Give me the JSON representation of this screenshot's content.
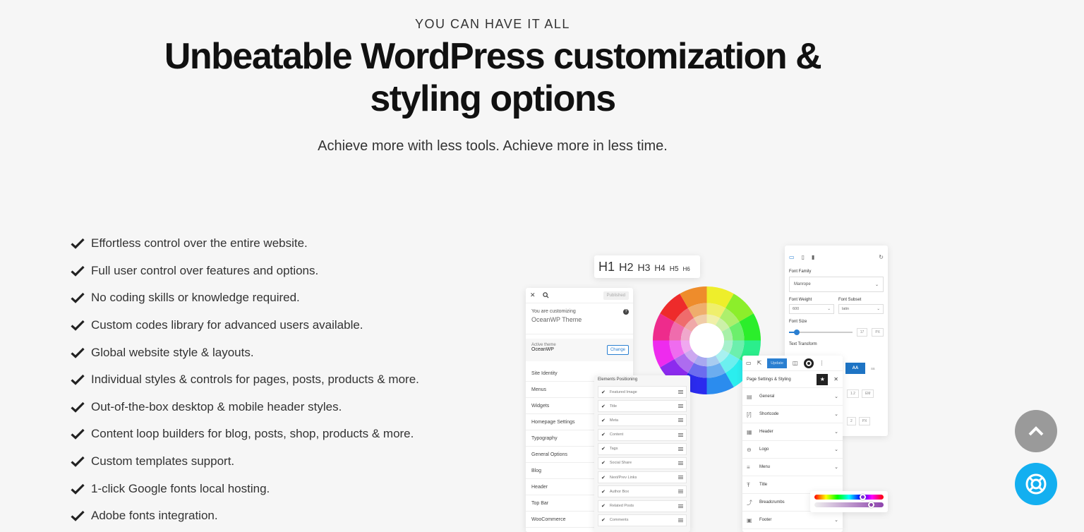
{
  "hero": {
    "eyebrow": "YOU CAN HAVE IT ALL",
    "headline_line1": "Unbeatable WordPress customization &",
    "headline_line2": "styling options",
    "subheadline": "Achieve more with less tools. Achieve more in less time."
  },
  "features": [
    "Effortless control over the entire website.",
    "Full user control over features and options.",
    "No coding skills or knowledge required.",
    "Custom codes library for advanced users available.",
    "Global website style & layouts.",
    "Individual styles & controls for pages, posts, products & more.",
    "Out-of-the-box desktop & mobile header styles.",
    "Content loop builders for blog, posts, shop, products & more.",
    "Custom templates support.",
    "1-click Google fonts local hosting.",
    "Adobe fonts integration."
  ],
  "mockup": {
    "headings": [
      "H1",
      "H2",
      "H3",
      "H4",
      "H5",
      "H6"
    ],
    "customizer": {
      "publish": "Published",
      "customizing_label": "You are customizing",
      "theme_name": "OceanWP Theme",
      "active_theme_label": "Active theme",
      "active_theme_name": "OceanWP",
      "change_button": "Change",
      "menu": [
        "Site Identity",
        "Menus",
        "Widgets",
        "Homepage Settings",
        "Typography",
        "General Options",
        "Blog",
        "Header",
        "Top Bar",
        "WooCommerce"
      ]
    },
    "elements_positioning": {
      "title": "Elements Positioning",
      "items": [
        "Featured Image",
        "Title",
        "Meta",
        "Content",
        "Tags",
        "Social Share",
        "Next/Prev Links",
        "Author Box",
        "Related Posts",
        "Comments"
      ]
    },
    "font_panel": {
      "family_label": "Font Family",
      "family_value": "Manrope",
      "weight_label": "Font Weight",
      "weight_value": "600",
      "subset_label": "Font Subset",
      "subset_value": "latin",
      "size_label": "Font Size",
      "size_value": "17",
      "size_unit": "PX",
      "transform_label": "Text Transform",
      "transform_active": "AA",
      "transform_other": "aa",
      "line_height_value": "1.2",
      "line_height_unit": "EM",
      "spacing_value": "2",
      "spacing_unit": "PX"
    },
    "page_settings": {
      "update_button": "Update",
      "title": "Page Settings & Styling",
      "items": [
        "General",
        "Shortcode",
        "Header",
        "Logo",
        "Menu",
        "Title",
        "Breadcrumbs",
        "Footer"
      ]
    }
  },
  "colors": {
    "accent": "#13aff0",
    "check": "#222222",
    "to_top": "#9a9a9a"
  }
}
